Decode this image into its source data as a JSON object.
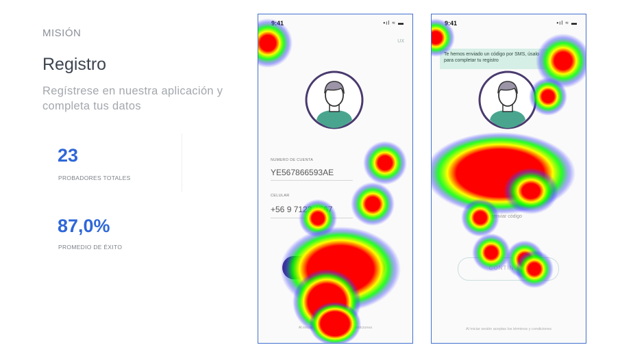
{
  "header": {
    "section": "MISIÓN",
    "title": "Registro",
    "description": "Regístrese en nuestra aplicación y completa tus datos"
  },
  "stats": [
    {
      "value": "23",
      "label": "PROBADORES TOTALES"
    },
    {
      "value": "87,0%",
      "label": "PROMEDIO DE ÉXITO"
    }
  ],
  "phone1": {
    "time": "9:41",
    "status": "•ıl ≈ ▬",
    "lang": "UX",
    "field1_label": "NUMERO DE CUENTA",
    "field1_value": "YE567866593AE",
    "field2_label": "CELULAR",
    "field2_value": "+56 9 7123 4567",
    "footer": "Al iniciar aceptas los términos y condiciones"
  },
  "phone2": {
    "time": "9:41",
    "status": "•ıl ≈ ▬",
    "toast": "Te hemos enviado un código por SMS, úsalo para completar tu registro",
    "resend": "reenviar código",
    "button": "CONTINUAR",
    "footer": "Al iniciar sesión aceptas los términos y condiciones"
  },
  "colors": {
    "accent": "#2f67d8",
    "frame": "#3f6fd0",
    "heat_hot": "#ff0000",
    "heat_warm": "#ffff00",
    "heat_cool": "#00ff00",
    "heat_cold": "#3333ff"
  }
}
